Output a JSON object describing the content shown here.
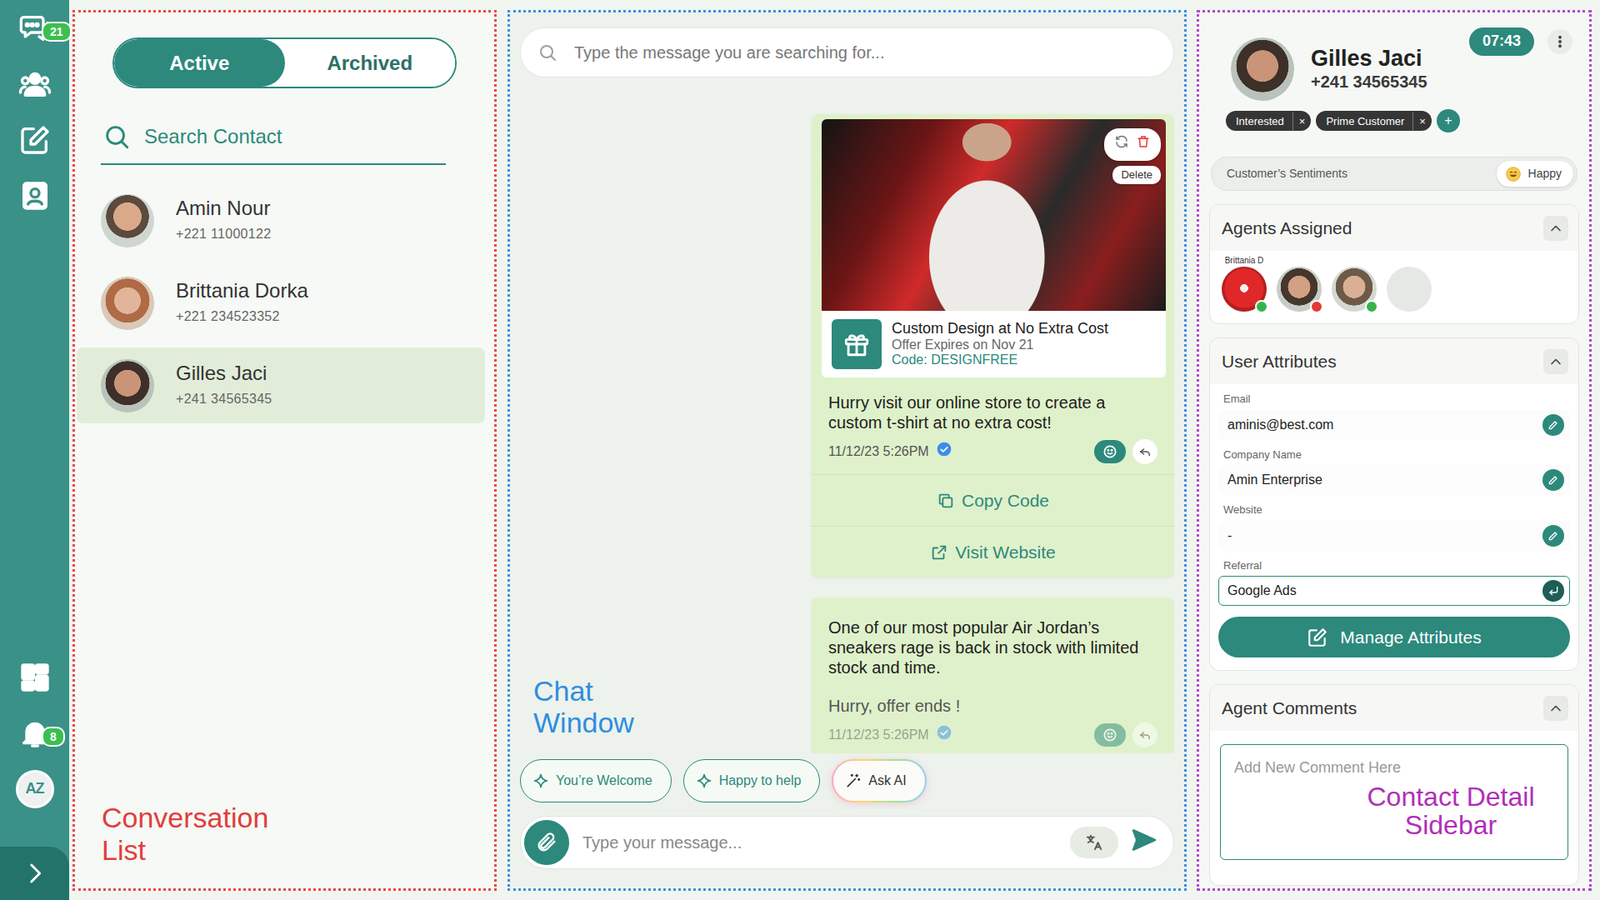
{
  "rail": {
    "chats_badge": "21",
    "alerts_badge": "8",
    "logo": "AZ"
  },
  "conversation_list": {
    "tabs": [
      {
        "label": "Active",
        "selected": true
      },
      {
        "label": "Archived",
        "selected": false
      }
    ],
    "search": {
      "placeholder": "Search Contact"
    },
    "contacts": [
      {
        "name": "Amin Nour",
        "phone": "+221 11000122",
        "selected": false
      },
      {
        "name": "Brittania Dorka",
        "phone": "+221 234523352",
        "selected": false
      },
      {
        "name": "Gilles Jaci",
        "phone": "+241 34565345",
        "selected": true
      }
    ],
    "annotation": "Conversation List"
  },
  "chat": {
    "search": {
      "placeholder": "Type the message you are searching for..."
    },
    "messages": [
      {
        "kind": "offer",
        "image_tooltip": "Delete",
        "offer": {
          "title": "Custom Design at No Extra Cost",
          "expires": "Offer Expires on Nov 21",
          "code": "Code: DESIGNFREE"
        },
        "paragraphs": [
          "Hurry visit our online store to create a custom t-shirt at no extra cost!"
        ],
        "time": "11/12/23 5:26PM",
        "read": true,
        "faded": false,
        "actions": [
          {
            "label": "Copy Code",
            "kind": "copy"
          },
          {
            "label": "Visit Website",
            "kind": "link"
          }
        ]
      },
      {
        "kind": "text",
        "paragraphs": [
          "One of our most popular Air Jordan’s sneakers rage is back in stock with limited stock and time.",
          "Hurry, offer ends !"
        ],
        "time": "11/12/23 5:26PM",
        "read": true,
        "faded": true,
        "actions": []
      }
    ],
    "annotation": "Chat Window",
    "quick_replies": [
      {
        "label": "You’re Welcome",
        "kind": "reply"
      },
      {
        "label": "Happy to help",
        "kind": "reply"
      },
      {
        "label": "Ask AI",
        "kind": "ai"
      }
    ],
    "composer": {
      "placeholder": "Type your message..."
    }
  },
  "sidebar": {
    "contact": {
      "name": "Gilles Jaci",
      "phone": "+241 34565345"
    },
    "time": "07:43",
    "tags": [
      {
        "label": "Interested",
        "remove": "×"
      },
      {
        "label": "Prime Customer",
        "remove": "×"
      }
    ],
    "add_tag": "+",
    "sentiment": {
      "label": "Customer’s Sentiments",
      "value": "Happy"
    },
    "agents": {
      "title": "Agents Assigned",
      "expanded": true,
      "hover_label": "Brittania D",
      "list": [
        {
          "kind": "agent",
          "color": "#35b44a"
        },
        {
          "kind": "agent",
          "color": "#e53935"
        },
        {
          "kind": "agent",
          "color": "#35b44a"
        },
        {
          "kind": "empty"
        }
      ]
    },
    "attributes": {
      "title": "User Attributes",
      "expanded": true,
      "fields": [
        {
          "label": "Email",
          "value": "aminis@best.com",
          "editing": false
        },
        {
          "label": "Company Name",
          "value": "Amin Enterprise",
          "editing": false
        },
        {
          "label": "Website",
          "value": "-",
          "editing": false
        },
        {
          "label": "Referral",
          "value": "Google Ads",
          "editing": true
        }
      ],
      "button": "Manage Attributes"
    },
    "comments": {
      "title": "Agent Comments",
      "expanded": true,
      "placeholder": "Add New Comment Here"
    },
    "annotation": "Contact Detail Sidebar"
  }
}
